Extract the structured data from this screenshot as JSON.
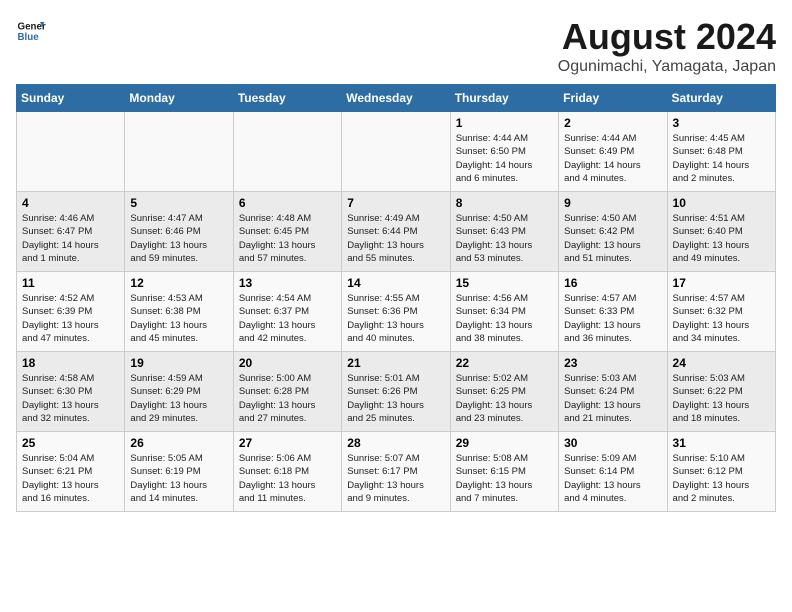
{
  "logo": {
    "line1": "General",
    "line2": "Blue"
  },
  "title": "August 2024",
  "subtitle": "Ogunimachi, Yamagata, Japan",
  "days_of_week": [
    "Sunday",
    "Monday",
    "Tuesday",
    "Wednesday",
    "Thursday",
    "Friday",
    "Saturday"
  ],
  "weeks": [
    [
      {
        "day": "",
        "info": ""
      },
      {
        "day": "",
        "info": ""
      },
      {
        "day": "",
        "info": ""
      },
      {
        "day": "",
        "info": ""
      },
      {
        "day": "1",
        "info": "Sunrise: 4:44 AM\nSunset: 6:50 PM\nDaylight: 14 hours\nand 6 minutes."
      },
      {
        "day": "2",
        "info": "Sunrise: 4:44 AM\nSunset: 6:49 PM\nDaylight: 14 hours\nand 4 minutes."
      },
      {
        "day": "3",
        "info": "Sunrise: 4:45 AM\nSunset: 6:48 PM\nDaylight: 14 hours\nand 2 minutes."
      }
    ],
    [
      {
        "day": "4",
        "info": "Sunrise: 4:46 AM\nSunset: 6:47 PM\nDaylight: 14 hours\nand 1 minute."
      },
      {
        "day": "5",
        "info": "Sunrise: 4:47 AM\nSunset: 6:46 PM\nDaylight: 13 hours\nand 59 minutes."
      },
      {
        "day": "6",
        "info": "Sunrise: 4:48 AM\nSunset: 6:45 PM\nDaylight: 13 hours\nand 57 minutes."
      },
      {
        "day": "7",
        "info": "Sunrise: 4:49 AM\nSunset: 6:44 PM\nDaylight: 13 hours\nand 55 minutes."
      },
      {
        "day": "8",
        "info": "Sunrise: 4:50 AM\nSunset: 6:43 PM\nDaylight: 13 hours\nand 53 minutes."
      },
      {
        "day": "9",
        "info": "Sunrise: 4:50 AM\nSunset: 6:42 PM\nDaylight: 13 hours\nand 51 minutes."
      },
      {
        "day": "10",
        "info": "Sunrise: 4:51 AM\nSunset: 6:40 PM\nDaylight: 13 hours\nand 49 minutes."
      }
    ],
    [
      {
        "day": "11",
        "info": "Sunrise: 4:52 AM\nSunset: 6:39 PM\nDaylight: 13 hours\nand 47 minutes."
      },
      {
        "day": "12",
        "info": "Sunrise: 4:53 AM\nSunset: 6:38 PM\nDaylight: 13 hours\nand 45 minutes."
      },
      {
        "day": "13",
        "info": "Sunrise: 4:54 AM\nSunset: 6:37 PM\nDaylight: 13 hours\nand 42 minutes."
      },
      {
        "day": "14",
        "info": "Sunrise: 4:55 AM\nSunset: 6:36 PM\nDaylight: 13 hours\nand 40 minutes."
      },
      {
        "day": "15",
        "info": "Sunrise: 4:56 AM\nSunset: 6:34 PM\nDaylight: 13 hours\nand 38 minutes."
      },
      {
        "day": "16",
        "info": "Sunrise: 4:57 AM\nSunset: 6:33 PM\nDaylight: 13 hours\nand 36 minutes."
      },
      {
        "day": "17",
        "info": "Sunrise: 4:57 AM\nSunset: 6:32 PM\nDaylight: 13 hours\nand 34 minutes."
      }
    ],
    [
      {
        "day": "18",
        "info": "Sunrise: 4:58 AM\nSunset: 6:30 PM\nDaylight: 13 hours\nand 32 minutes."
      },
      {
        "day": "19",
        "info": "Sunrise: 4:59 AM\nSunset: 6:29 PM\nDaylight: 13 hours\nand 29 minutes."
      },
      {
        "day": "20",
        "info": "Sunrise: 5:00 AM\nSunset: 6:28 PM\nDaylight: 13 hours\nand 27 minutes."
      },
      {
        "day": "21",
        "info": "Sunrise: 5:01 AM\nSunset: 6:26 PM\nDaylight: 13 hours\nand 25 minutes."
      },
      {
        "day": "22",
        "info": "Sunrise: 5:02 AM\nSunset: 6:25 PM\nDaylight: 13 hours\nand 23 minutes."
      },
      {
        "day": "23",
        "info": "Sunrise: 5:03 AM\nSunset: 6:24 PM\nDaylight: 13 hours\nand 21 minutes."
      },
      {
        "day": "24",
        "info": "Sunrise: 5:03 AM\nSunset: 6:22 PM\nDaylight: 13 hours\nand 18 minutes."
      }
    ],
    [
      {
        "day": "25",
        "info": "Sunrise: 5:04 AM\nSunset: 6:21 PM\nDaylight: 13 hours\nand 16 minutes."
      },
      {
        "day": "26",
        "info": "Sunrise: 5:05 AM\nSunset: 6:19 PM\nDaylight: 13 hours\nand 14 minutes."
      },
      {
        "day": "27",
        "info": "Sunrise: 5:06 AM\nSunset: 6:18 PM\nDaylight: 13 hours\nand 11 minutes."
      },
      {
        "day": "28",
        "info": "Sunrise: 5:07 AM\nSunset: 6:17 PM\nDaylight: 13 hours\nand 9 minutes."
      },
      {
        "day": "29",
        "info": "Sunrise: 5:08 AM\nSunset: 6:15 PM\nDaylight: 13 hours\nand 7 minutes."
      },
      {
        "day": "30",
        "info": "Sunrise: 5:09 AM\nSunset: 6:14 PM\nDaylight: 13 hours\nand 4 minutes."
      },
      {
        "day": "31",
        "info": "Sunrise: 5:10 AM\nSunset: 6:12 PM\nDaylight: 13 hours\nand 2 minutes."
      }
    ]
  ]
}
